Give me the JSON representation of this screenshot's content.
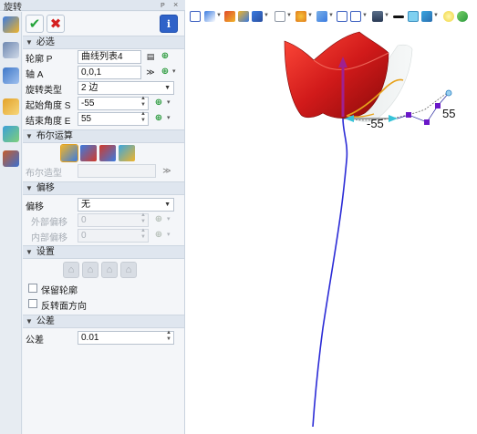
{
  "window": {
    "title": "旋转",
    "pin_glyph": "ᴘ",
    "close_glyph": "×"
  },
  "actions": {
    "ok_glyph": "✔",
    "cancel_glyph": "✖",
    "info_glyph": "i"
  },
  "sections": {
    "required": "必选",
    "boolean": "布尔运算",
    "offset": "偏移",
    "settings": "设置",
    "tolerance": "公差"
  },
  "required": {
    "profile": {
      "label": "轮廓 P",
      "value": "曲线列表4"
    },
    "axis": {
      "label": "轴 A",
      "value": "0,0,1"
    },
    "rotation_type": {
      "label": "旋转类型",
      "value": "2 边"
    },
    "start_angle": {
      "label": "起始角度 S",
      "value": "-55"
    },
    "end_angle": {
      "label": "结束角度 E",
      "value": "55"
    }
  },
  "boolean": {
    "shape_label": "布尔造型",
    "shape_value": ""
  },
  "offset": {
    "offset": {
      "label": "偏移",
      "value": "无"
    },
    "outer": {
      "label": "外部偏移",
      "value": "0"
    },
    "inner": {
      "label": "内部偏移",
      "value": "0"
    }
  },
  "settings": {
    "keep_profile": "保留轮廓",
    "reverse_face": "反转面方向"
  },
  "tolerance": {
    "label": "公差",
    "value": "0.01"
  },
  "viewport": {
    "label_start": "-55",
    "label_end": "55"
  },
  "colors": {
    "accent_blue": "#2f62c8",
    "ok_green": "#24a33a",
    "cancel_red": "#d42020",
    "solid_red": "#d11a1a",
    "curve_blue": "#2b2bd6",
    "axis_magenta": "#a0208f"
  }
}
